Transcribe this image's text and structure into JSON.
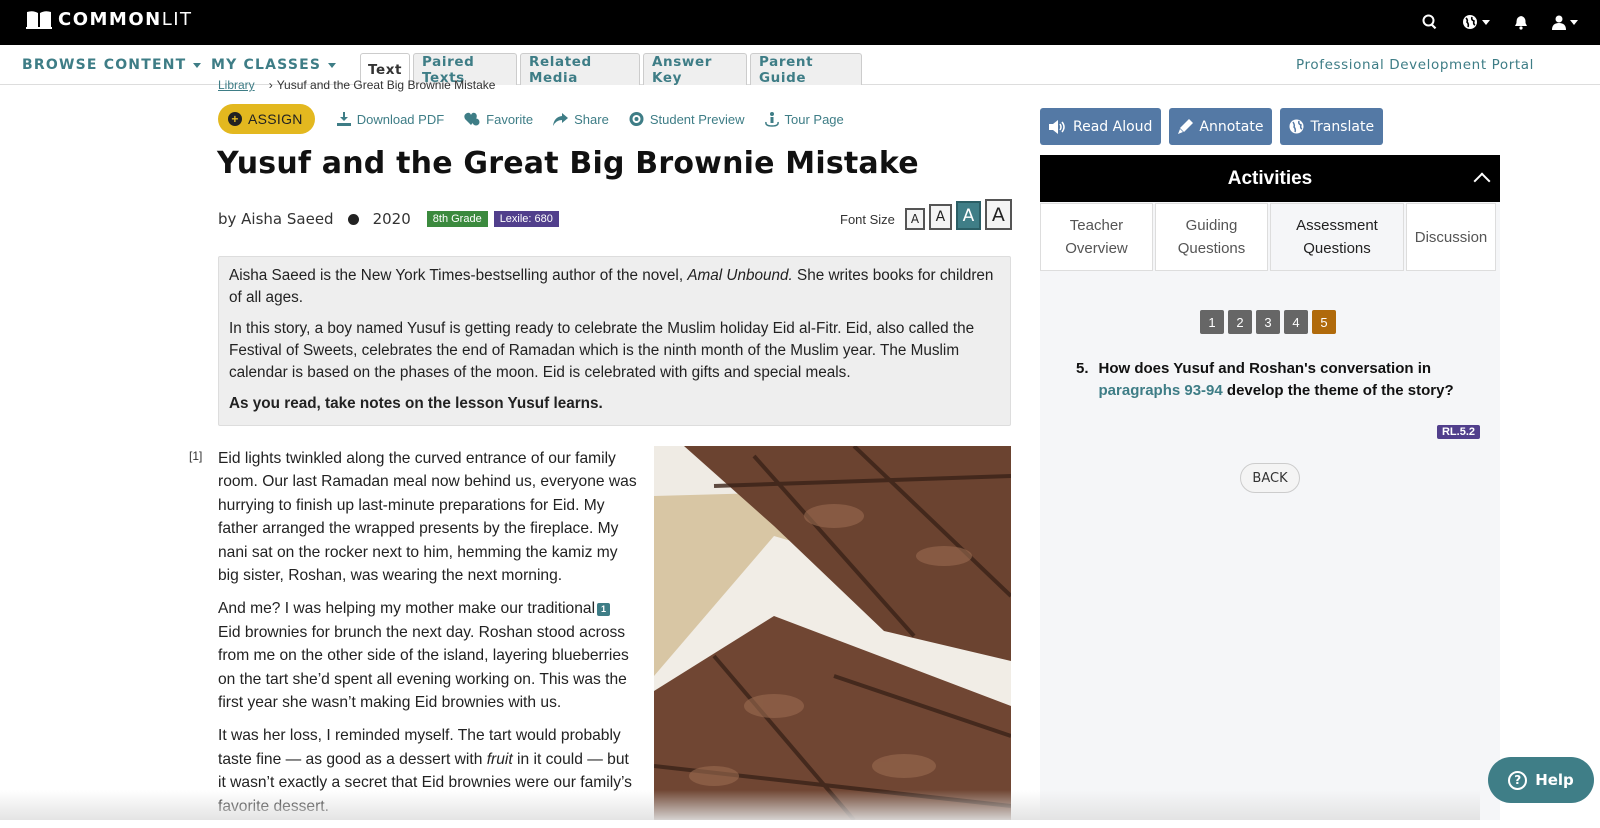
{
  "app": {
    "logo_bold": "COMMON",
    "logo_light": "LIT"
  },
  "topbar_icons": [
    "search-icon",
    "globe-icon",
    "bell-icon",
    "user-icon"
  ],
  "nav": {
    "browse": "BROWSE CONTENT",
    "classes": "MY CLASSES",
    "tabs": [
      "Text",
      "Paired Texts",
      "Related Media",
      "Answer Key",
      "Parent Guide"
    ],
    "active_tab": "Text",
    "pd_portal": "Professional Development Portal"
  },
  "breadcrumb": {
    "root": "Library",
    "current": "Yusuf and the Great Big Brownie Mistake"
  },
  "actions": {
    "assign": "ASSIGN",
    "download": "Download PDF",
    "favorite": "Favorite",
    "share": "Share",
    "preview": "Student Preview",
    "tour": "Tour Page"
  },
  "text": {
    "title": "Yusuf and the Great Big Brownie Mistake",
    "author": "by Aisha Saeed",
    "year": "2020",
    "grade": "8th Grade",
    "lexile": "Lexile: 680",
    "font_size_label": "Font Size",
    "font_size_options": [
      "A",
      "A",
      "A",
      "A"
    ],
    "font_size_selected_index": 2
  },
  "intro": {
    "p1_before": "Aisha Saeed is the New York Times-bestselling author of the novel, ",
    "p1_italic": "Amal Unbound.",
    "p1_after": " She writes books for children of all ages.",
    "p2": "In this story, a boy named Yusuf is getting ready to celebrate the Muslim holiday Eid al-Fitr. Eid, also called the Festival of Sweets, celebrates the end of Ramadan which is the ninth month of the Muslim year. The Muslim calendar is based on the phases of the moon. Eid is celebrated with gifts and special meals.",
    "p3": "As you read, take notes on the lesson Yusuf learns."
  },
  "story": {
    "para_number": "[1]",
    "p1": "Eid lights twinkled along the curved entrance of our family room. Our last Ramadan meal now behind us, everyone was hurrying to finish up last-minute preparations for Eid. My father arranged the wrapped presents by the fireplace. My nani sat on the rocker next to him, hemming the kamiz my big sister, Roshan, was wearing the next morning.",
    "p2_before": "And me? I was helping my mother make our traditional",
    "footnote": "1",
    "p2_after": " Eid brownies for brunch the next day. Roshan stood across from me on the other side of the island, layering blueberries on the tart she’d spent all evening working on. This was the first year she wasn’t making Eid brownies with us.",
    "p3_before": "It was her loss, I reminded myself. The tart would probably taste fine — as good as a dessert with ",
    "p3_italic": "fruit",
    "p3_after": " in it could — but it wasn’t exactly a secret that Eid brownies were our family’s favorite dessert.",
    "image": "brownies-photo"
  },
  "tools": {
    "read_aloud": "Read Aloud",
    "annotate": "Annotate",
    "translate": "Translate"
  },
  "activities": {
    "heading": "Activities",
    "tabs": [
      {
        "line1": "Teacher",
        "line2": "Overview"
      },
      {
        "line1": "Guiding",
        "line2": "Questions"
      },
      {
        "line1": "Assessment",
        "line2": "Questions"
      },
      {
        "line1": "Discussion",
        "line2": ""
      }
    ],
    "active_tab_index": 2,
    "question_numbers": [
      "1",
      "2",
      "3",
      "4",
      "5"
    ],
    "active_question": "5",
    "question": {
      "number": "5.",
      "before": "How does Yusuf and Roshan's conversation in ",
      "link": "paragraphs 93-94",
      "after": " develop the theme of the story?"
    },
    "standard": "RL.5.2",
    "back": "BACK"
  },
  "help": "Help",
  "colors": {
    "teal": "#3e7d86",
    "assign": "#e3b81f",
    "tool_blue": "#5479a5",
    "grade": "#3b8a3e",
    "lexile": "#513f8c",
    "active_q": "#b06a0b"
  }
}
